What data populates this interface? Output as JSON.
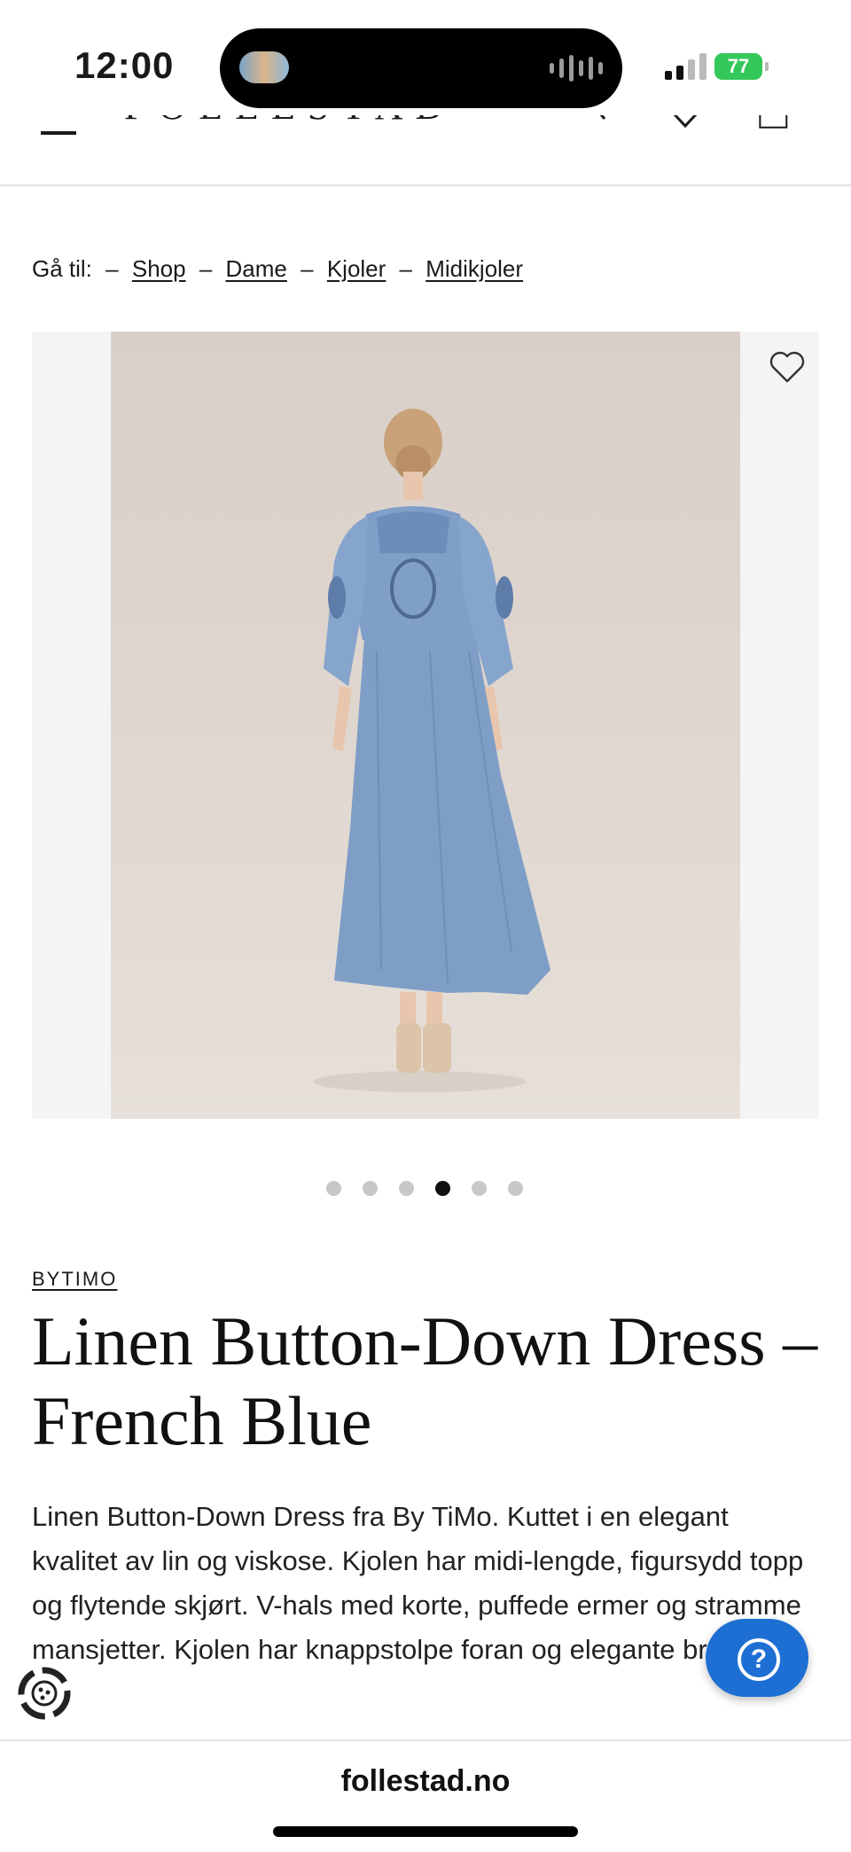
{
  "status_bar": {
    "time": "12:00",
    "battery": "77"
  },
  "header": {
    "logo": "FOLLESTAD"
  },
  "breadcrumb": {
    "prefix": "Gå til:",
    "separator": "–",
    "items": [
      "Shop",
      "Dame",
      "Kjoler",
      "Midikjoler"
    ]
  },
  "gallery": {
    "image_count": 6,
    "active_index": 3
  },
  "product": {
    "brand": "BYTIMO",
    "title": "Linen Button-Down Dress – French Blue",
    "description": "Linen Button-Down Dress fra By TiMo. Kuttet i en elegant kvalitet av lin og viskose. Kjolen har midi-lengde, figursydd topp og flytende skjørt. V-hals med korte, puffede ermer og stramme mansjetter. Kjolen har knappstolpe foran og elegante broderier."
  },
  "help_button": {
    "label": "?"
  },
  "browser": {
    "url": "follestad.no"
  },
  "colors": {
    "accent_blue": "#1d6fd3",
    "dress_blue": "#7f9fc8",
    "photo_bg": "#ddd3cc",
    "text": "#1a1a1a"
  },
  "icons": [
    "hamburger-icon",
    "search-icon",
    "chevron-down-icon",
    "bag-icon",
    "heart-icon",
    "question-icon",
    "cookie-icon"
  ]
}
